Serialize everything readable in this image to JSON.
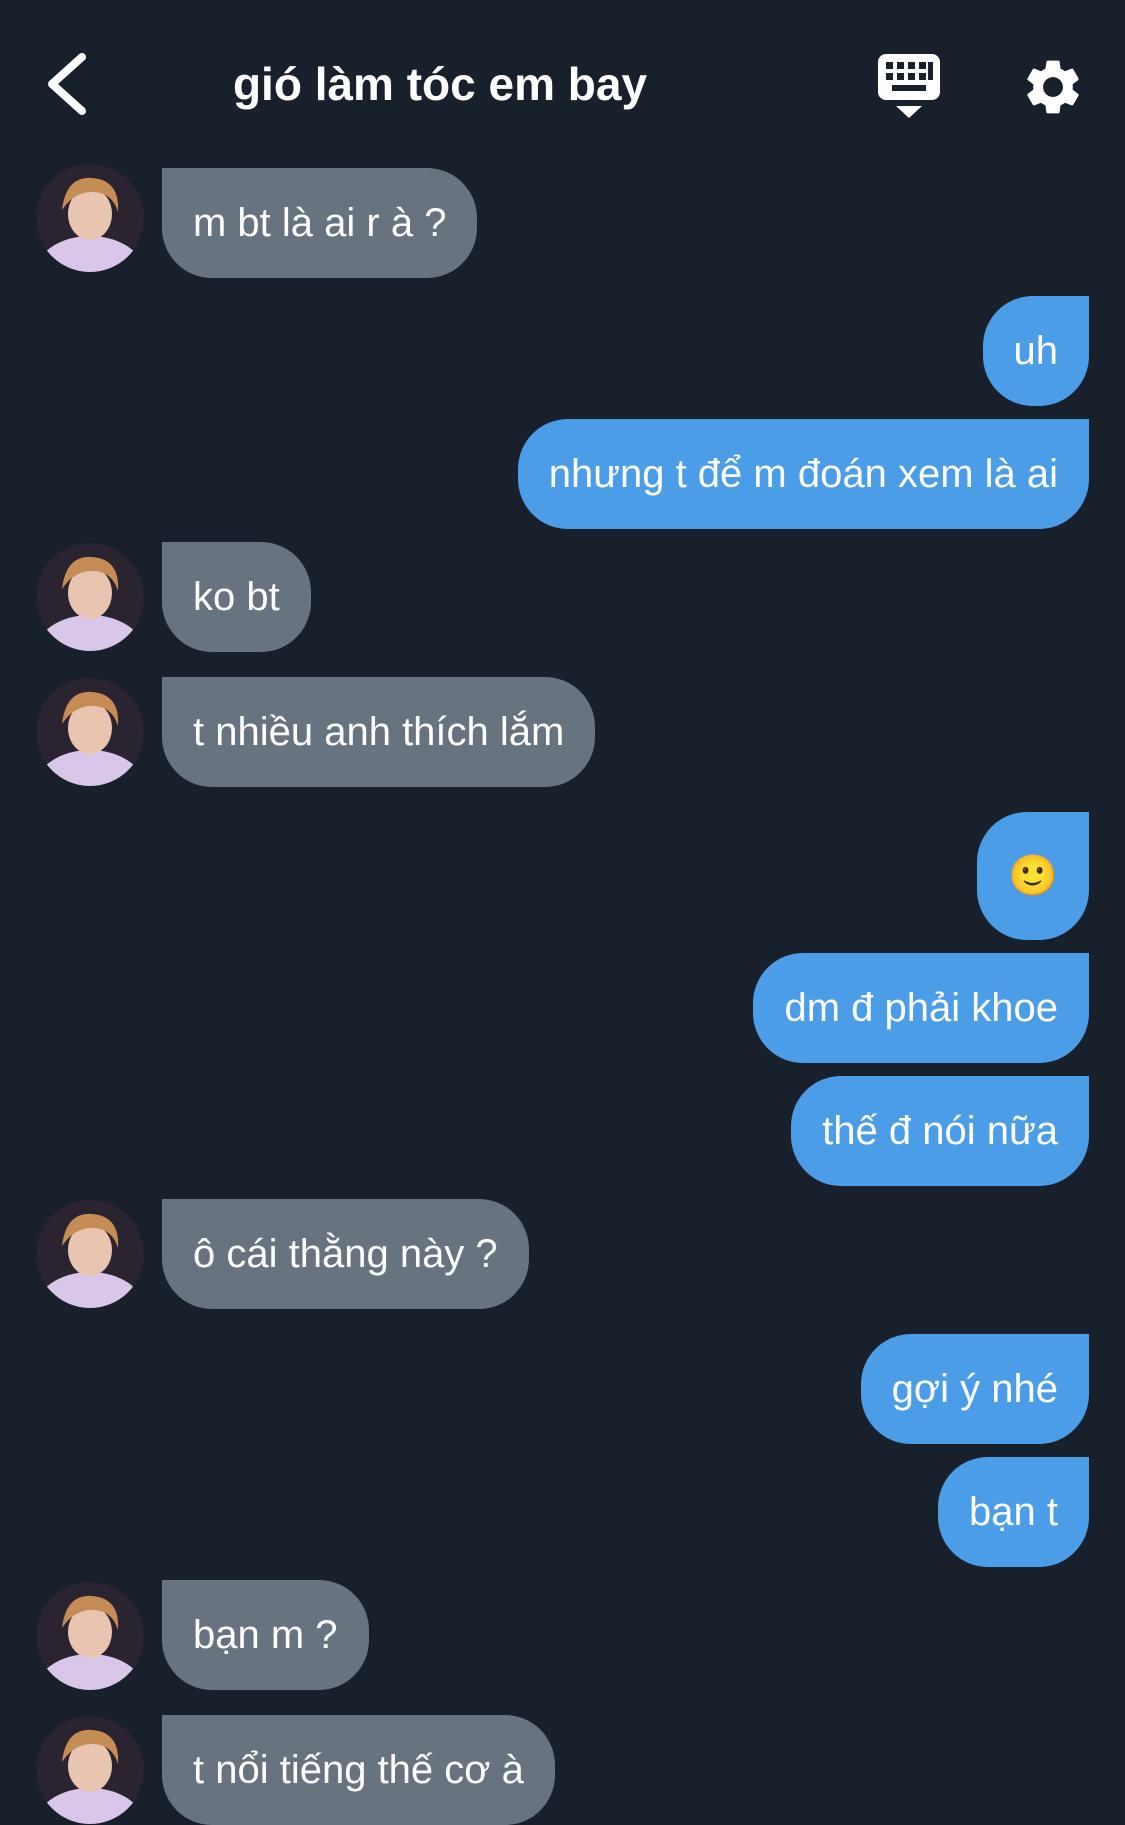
{
  "header": {
    "title": "gió làm tóc em bay",
    "back_icon": "chevron-left-icon",
    "keyboard_icon": "keyboard-icon",
    "settings_icon": "gear-icon"
  },
  "colors": {
    "background": "#18202b",
    "incoming_bubble": "#67737f",
    "outgoing_bubble": "#4c9de8",
    "text": "#ffffff"
  },
  "messages": [
    {
      "direction": "in",
      "text": "m bt là ai r à ?"
    },
    {
      "direction": "out",
      "text": "uh"
    },
    {
      "direction": "out",
      "text": "nhưng t để m đoán xem là ai"
    },
    {
      "direction": "in",
      "text": "ko bt"
    },
    {
      "direction": "in",
      "text": "t nhiều anh thích lắm"
    },
    {
      "direction": "out",
      "text": "🙂"
    },
    {
      "direction": "out",
      "text": "dm đ phải khoe"
    },
    {
      "direction": "out",
      "text": "thế đ nói nữa"
    },
    {
      "direction": "in",
      "text": "ô cái thằng này ?"
    },
    {
      "direction": "out",
      "text": "gợi ý nhé"
    },
    {
      "direction": "out",
      "text": "bạn t"
    },
    {
      "direction": "in",
      "text": "bạn m ?"
    },
    {
      "direction": "in",
      "text": "t nổi tiếng thế cơ à"
    }
  ]
}
